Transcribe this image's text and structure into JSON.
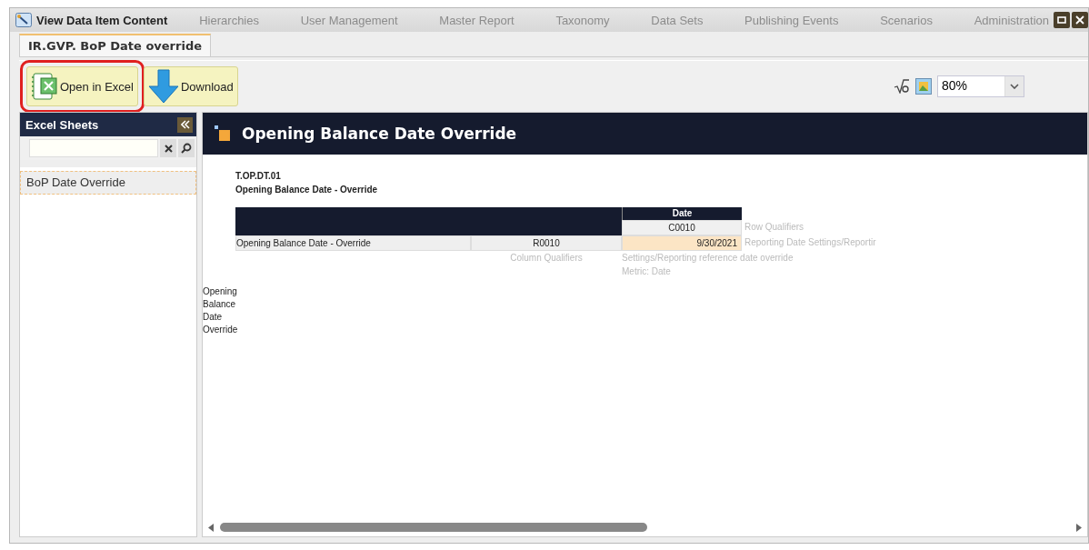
{
  "window": {
    "title": "View Data Item Content"
  },
  "background_nav": [
    "Hierarchies",
    "User Management",
    "Master Report",
    "Taxonomy",
    "Data Sets",
    "Publishing Events",
    "Scenarios",
    "Administration"
  ],
  "tabs": [
    {
      "label": "IR.GVP. BoP Date override",
      "selected": true
    }
  ],
  "toolbar": {
    "buttons": [
      {
        "label": "Open in Excel",
        "kind": "excel",
        "highlighted": true
      },
      {
        "label": "Download",
        "kind": "download",
        "highlighted": false
      }
    ],
    "zoom": "80%"
  },
  "sidebar": {
    "title": "Excel Sheets",
    "items": [
      {
        "label": "BoP Date Override",
        "selected": true
      }
    ]
  },
  "sheet": {
    "title": "Opening Balance Date Override",
    "code": "T.OP.DT.01",
    "subtitle": "Opening Balance Date - Override",
    "column_header": "Date",
    "column_code": "C0010",
    "row_qualifiers_label": "Row Qualifiers",
    "rows": [
      {
        "label": "Opening Balance Date - Override",
        "code": "R0010",
        "value": "9/30/2021",
        "qualifier": "Reporting Date Settings/Reportir"
      }
    ],
    "column_qualifiers_label": "Column Qualifiers",
    "column_qualifiers": [
      "Settings/Reporting reference date override",
      "Metric: Date"
    ],
    "side_label": "Opening Balance Date Override"
  }
}
